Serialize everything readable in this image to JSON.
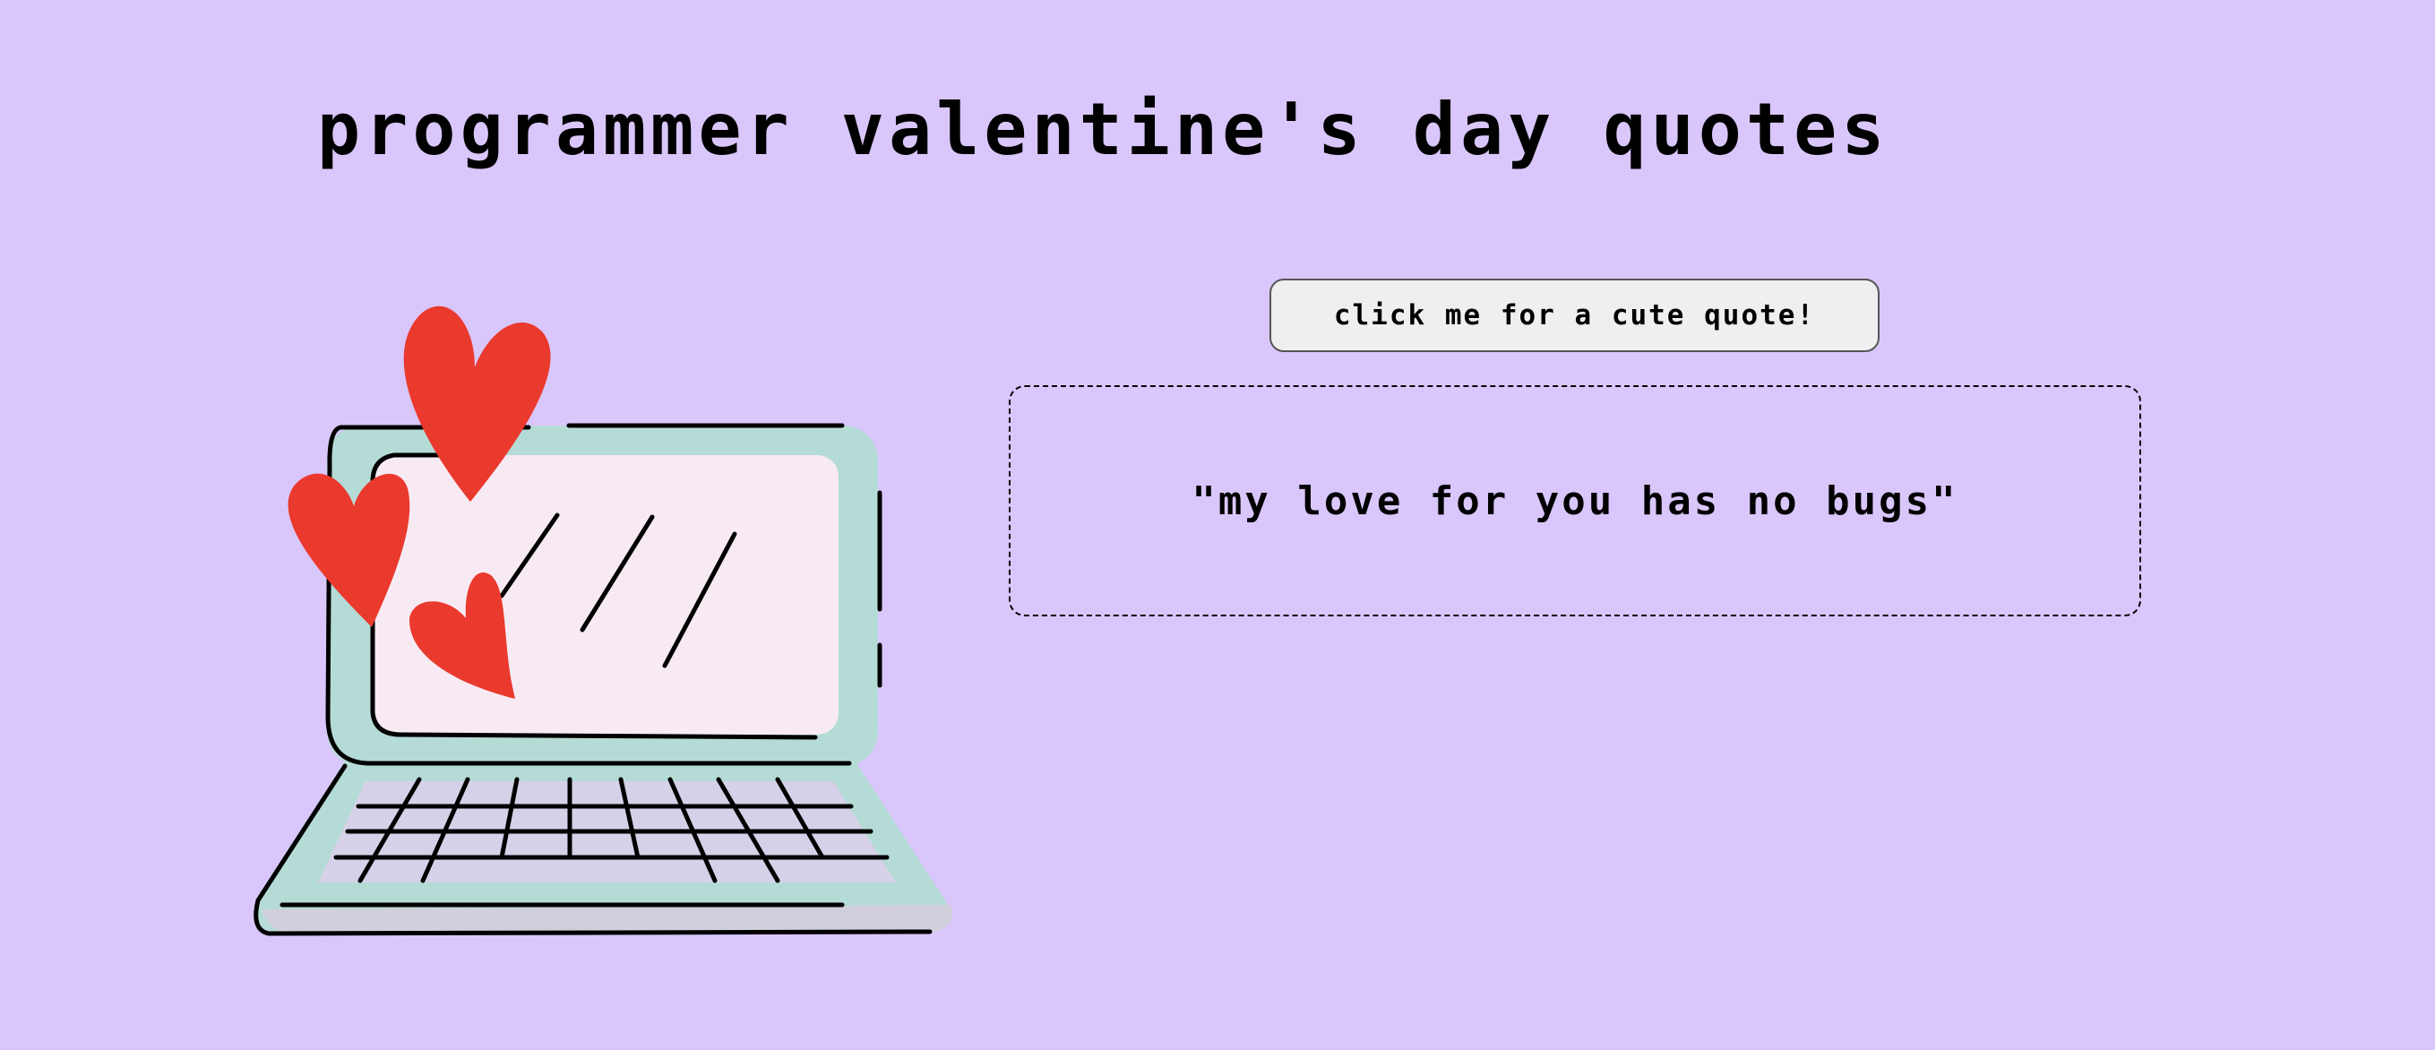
{
  "page": {
    "title": "programmer valentine's day quotes",
    "background_color": "#d9c7fb"
  },
  "illustration": {
    "icon": "laptop-with-hearts-illustration",
    "colors": {
      "laptop_body": "#b5dbd6",
      "screen": "#f8eaf3",
      "keyboard": "#d6d1e8",
      "hearts": "#ea392d",
      "outline": "#000000"
    }
  },
  "quote_button": {
    "label": "click me for a cute quote!"
  },
  "quote_box": {
    "text": "\"my love for you has no bugs\""
  }
}
